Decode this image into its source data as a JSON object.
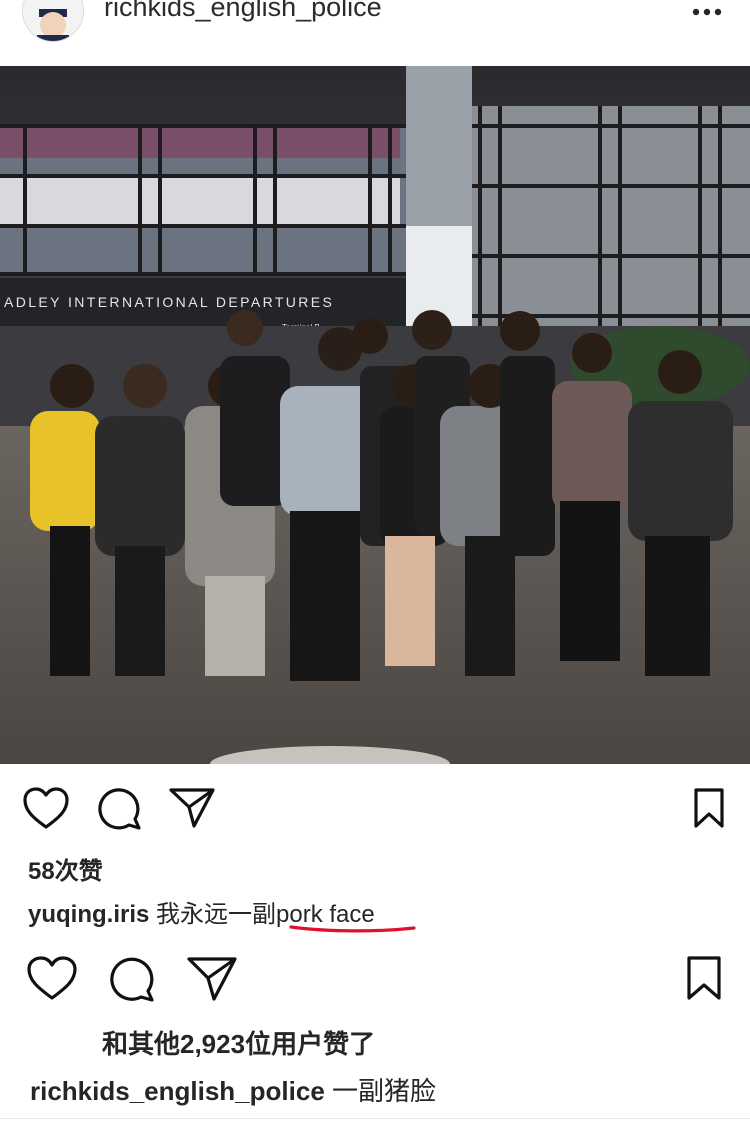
{
  "post_header": {
    "username": "richkids_english_police",
    "avatar_icon": "cartoon-police-avatar",
    "more_icon": "more-dots-icon"
  },
  "photo": {
    "sign_text": "ADLEY INTERNATIONAL DEPARTURES",
    "terminal_text": "Terminal B"
  },
  "inner_post": {
    "likes": "58次赞",
    "caption_user": "yuqing.iris",
    "caption_text_cn": " 我永远一副",
    "caption_text_en": "pork face",
    "underline_color": "#e0112b"
  },
  "outer_post": {
    "likes_text": "和其他2,923位用户赞了",
    "caption_user": "richkids_english_police",
    "caption_text": " 一副猪脸"
  },
  "icons": [
    "heart-icon",
    "comment-icon",
    "share-icon",
    "bookmark-icon"
  ]
}
